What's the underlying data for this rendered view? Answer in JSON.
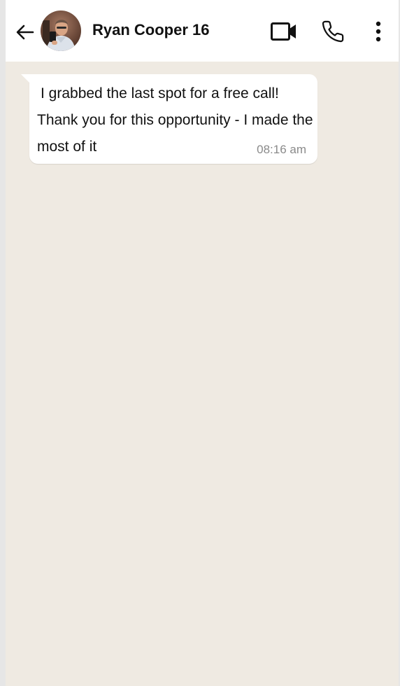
{
  "header": {
    "contact_name": "Ryan Cooper 16"
  },
  "icons": {
    "back": "arrow-left-icon",
    "video": "video-camera-icon",
    "phone": "phone-icon",
    "menu": "more-vertical-icon"
  },
  "messages": [
    {
      "text": "I grabbed the last spot for a free call! Thank you for this opportunity - I made the most of it",
      "time": "08:16 am"
    }
  ],
  "colors": {
    "header_bg": "#ffffff",
    "chat_bg": "#efeae2",
    "bubble_bg": "#ffffff",
    "timestamp": "#8a8a8a"
  }
}
